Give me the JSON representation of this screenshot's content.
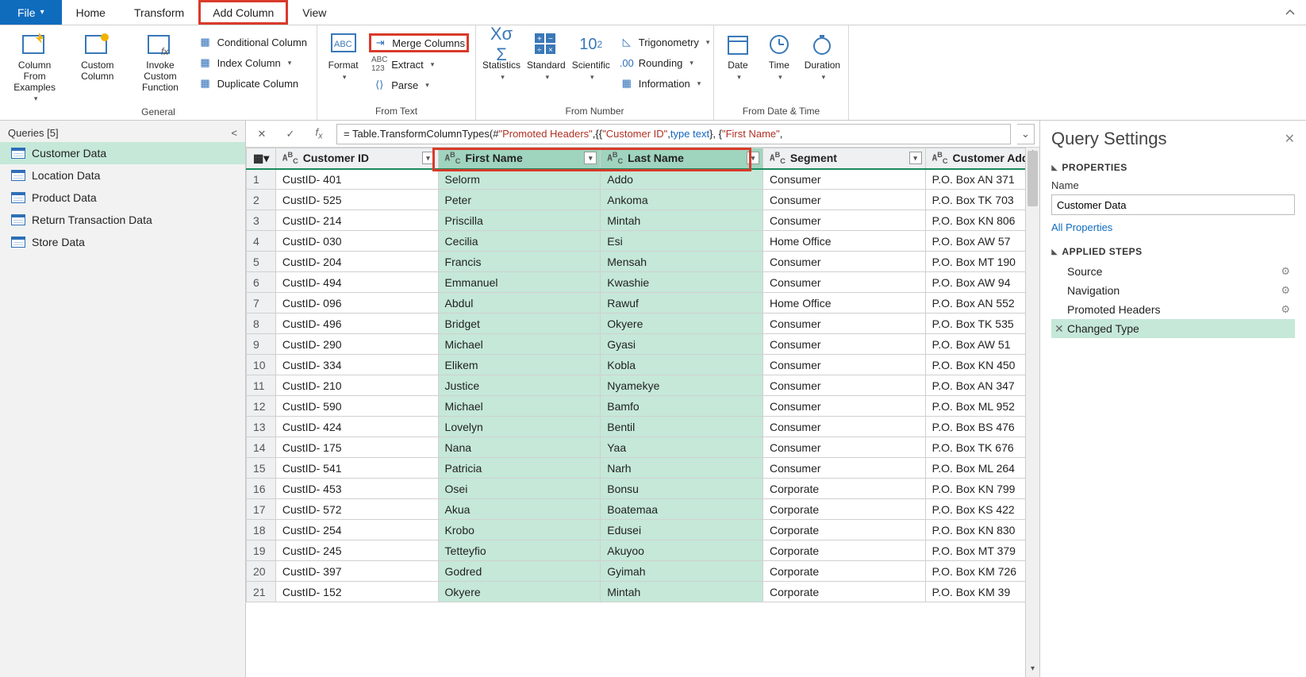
{
  "tabs": {
    "file": "File",
    "home": "Home",
    "transform": "Transform",
    "add": "Add Column",
    "view": "View"
  },
  "ribbon": {
    "general": {
      "label": "General",
      "col_examples": "Column From\nExamples",
      "custom_col": "Custom\nColumn",
      "invoke": "Invoke Custom\nFunction",
      "cond": "Conditional Column",
      "index": "Index Column",
      "dup": "Duplicate Column"
    },
    "fromtext": {
      "label": "From Text",
      "format": "Format",
      "merge": "Merge Columns",
      "extract": "Extract",
      "parse": "Parse"
    },
    "fromnumber": {
      "label": "From Number",
      "stats": "Statistics",
      "standard": "Standard",
      "sci": "Scientific",
      "trig": "Trigonometry",
      "round": "Rounding",
      "info": "Information"
    },
    "fromdate": {
      "label": "From Date & Time",
      "date": "Date",
      "time": "Time",
      "duration": "Duration"
    }
  },
  "queries": {
    "header": "Queries [5]",
    "items": [
      "Customer Data",
      "Location Data",
      "Product Data",
      "Return Transaction Data",
      "Store Data"
    ],
    "active": 0
  },
  "formula": {
    "prefix": "= Table.TransformColumnTypes(#",
    "str1": "\"Promoted Headers\"",
    "mid": ",{{",
    "str2": "\"Customer ID\"",
    "mid2": ", ",
    "kw": "type text",
    "mid3": "}, {",
    "str3": "\"First Name\"",
    "tail": ","
  },
  "columns": [
    "Customer ID",
    "First Name",
    "Last Name",
    "Segment",
    "Customer Add"
  ],
  "rows": [
    {
      "n": 1,
      "id": "CustID- 401",
      "fn": "Selorm",
      "ln": "Addo",
      "seg": "Consumer",
      "addr": "P.O. Box AN 371"
    },
    {
      "n": 2,
      "id": "CustID- 525",
      "fn": "Peter",
      "ln": "Ankoma",
      "seg": "Consumer",
      "addr": "P.O. Box TK 703"
    },
    {
      "n": 3,
      "id": "CustID- 214",
      "fn": "Priscilla",
      "ln": "Mintah",
      "seg": "Consumer",
      "addr": "P.O. Box KN 806"
    },
    {
      "n": 4,
      "id": "CustID- 030",
      "fn": "Cecilia",
      "ln": "Esi",
      "seg": "Home Office",
      "addr": "P.O. Box AW 57"
    },
    {
      "n": 5,
      "id": "CustID- 204",
      "fn": "Francis",
      "ln": "Mensah",
      "seg": "Consumer",
      "addr": "P.O. Box MT 190"
    },
    {
      "n": 6,
      "id": "CustID- 494",
      "fn": "Emmanuel",
      "ln": "Kwashie",
      "seg": "Consumer",
      "addr": "P.O. Box AW 94"
    },
    {
      "n": 7,
      "id": "CustID- 096",
      "fn": "Abdul",
      "ln": "Rawuf",
      "seg": "Home Office",
      "addr": "P.O. Box AN 552"
    },
    {
      "n": 8,
      "id": "CustID- 496",
      "fn": "Bridget",
      "ln": "Okyere",
      "seg": "Consumer",
      "addr": "P.O. Box TK 535"
    },
    {
      "n": 9,
      "id": "CustID- 290",
      "fn": "Michael",
      "ln": "Gyasi",
      "seg": "Consumer",
      "addr": "P.O. Box AW 51"
    },
    {
      "n": 10,
      "id": "CustID- 334",
      "fn": "Elikem",
      "ln": "Kobla",
      "seg": "Consumer",
      "addr": "P.O. Box KN 450"
    },
    {
      "n": 11,
      "id": "CustID- 210",
      "fn": "Justice",
      "ln": "Nyamekye",
      "seg": "Consumer",
      "addr": "P.O. Box AN 347"
    },
    {
      "n": 12,
      "id": "CustID- 590",
      "fn": "Michael",
      "ln": "Bamfo",
      "seg": "Consumer",
      "addr": "P.O. Box ML 952"
    },
    {
      "n": 13,
      "id": "CustID- 424",
      "fn": "Lovelyn",
      "ln": "Bentil",
      "seg": "Consumer",
      "addr": "P.O. Box BS 476"
    },
    {
      "n": 14,
      "id": "CustID- 175",
      "fn": "Nana",
      "ln": "Yaa",
      "seg": "Consumer",
      "addr": "P.O. Box TK 676"
    },
    {
      "n": 15,
      "id": "CustID- 541",
      "fn": "Patricia",
      "ln": "Narh",
      "seg": "Consumer",
      "addr": "P.O. Box ML 264"
    },
    {
      "n": 16,
      "id": "CustID- 453",
      "fn": "Osei",
      "ln": "Bonsu",
      "seg": "Corporate",
      "addr": "P.O. Box KN 799"
    },
    {
      "n": 17,
      "id": "CustID- 572",
      "fn": "Akua",
      "ln": "Boatemaa",
      "seg": "Corporate",
      "addr": "P.O. Box KS 422"
    },
    {
      "n": 18,
      "id": "CustID- 254",
      "fn": "Krobo",
      "ln": "Edusei",
      "seg": "Corporate",
      "addr": "P.O. Box KN 830"
    },
    {
      "n": 19,
      "id": "CustID- 245",
      "fn": "Tetteyfio",
      "ln": "Akuyoo",
      "seg": "Corporate",
      "addr": "P.O. Box MT 379"
    },
    {
      "n": 20,
      "id": "CustID- 397",
      "fn": "Godred",
      "ln": "Gyimah",
      "seg": "Corporate",
      "addr": "P.O. Box KM 726"
    },
    {
      "n": 21,
      "id": "CustID- 152",
      "fn": "Okyere",
      "ln": "Mintah",
      "seg": "Corporate",
      "addr": "P.O. Box KM 39"
    }
  ],
  "settings": {
    "title": "Query Settings",
    "properties_hdr": "PROPERTIES",
    "name_label": "Name",
    "name_value": "Customer Data",
    "all_props": "All Properties",
    "steps_hdr": "APPLIED STEPS",
    "steps": [
      "Source",
      "Navigation",
      "Promoted Headers",
      "Changed Type"
    ],
    "active_step": 3
  }
}
